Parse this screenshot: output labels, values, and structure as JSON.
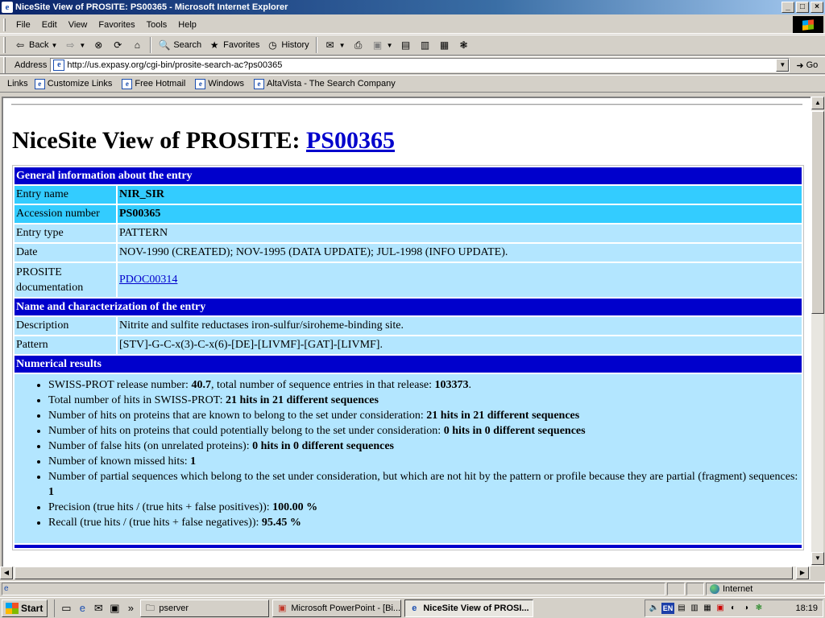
{
  "window": {
    "title": "NiceSite View of PROSITE: PS00365 - Microsoft Internet Explorer",
    "controls": [
      "_",
      "□",
      "×"
    ]
  },
  "menu": [
    "File",
    "Edit",
    "View",
    "Favorites",
    "Tools",
    "Help"
  ],
  "toolbar": {
    "back": "Back",
    "search": "Search",
    "favorites": "Favorites",
    "history": "History"
  },
  "address": {
    "label": "Address",
    "url": "http://us.expasy.org/cgi-bin/prosite-search-ac?ps00365",
    "go": "Go"
  },
  "links": {
    "label": "Links",
    "items": [
      "Customize Links",
      "Free Hotmail",
      "Windows",
      "AltaVista - The Search Company"
    ]
  },
  "page": {
    "title_prefix": "NiceSite View of PROSITE: ",
    "title_link": "PS00365",
    "sections": {
      "general": "General information about the entry",
      "name": "Name and characterization of the entry",
      "numerical": "Numerical results"
    },
    "general": {
      "entry_name_label": "Entry name",
      "entry_name": "NIR_SIR",
      "accession_label": "Accession number",
      "accession": "PS00365",
      "type_label": "Entry type",
      "type": "PATTERN",
      "date_label": "Date",
      "date": "NOV-1990 (CREATED); NOV-1995 (DATA UPDATE); JUL-1998 (INFO UPDATE).",
      "doc_label": "PROSITE documentation",
      "doc": "PDOC00314"
    },
    "characterization": {
      "description_label": "Description",
      "description": "Nitrite and sulfite reductases iron-sulfur/siroheme-binding site.",
      "pattern_label": "Pattern",
      "pattern": "[STV]-G-C-x(3)-C-x(6)-[DE]-[LIVMF]-[GAT]-[LIVMF]."
    },
    "results": [
      {
        "text": "SWISS-PROT release number: ",
        "b1": "40.7",
        "mid": ", total number of sequence entries in that release: ",
        "b2": "103373",
        "end": "."
      },
      {
        "text": "Total number of hits in SWISS-PROT: ",
        "b1": "21 hits in 21 different sequences"
      },
      {
        "text": "Number of hits on proteins that are known to belong to the set under consideration: ",
        "b1": "21 hits in 21 different sequences"
      },
      {
        "text": "Number of hits on proteins that could potentially belong to the set under consideration: ",
        "b1": "0 hits in 0 different sequences"
      },
      {
        "text": "Number of false hits (on unrelated proteins): ",
        "b1": "0 hits in 0 different sequences"
      },
      {
        "text": "Number of known missed hits: ",
        "b1": "1"
      },
      {
        "text": "Number of partial sequences which belong to the set under consideration, but which are not hit by the pattern or profile because they are partial (fragment) sequences: ",
        "b1": "1"
      },
      {
        "text": "Precision (true hits / (true hits + false positives)): ",
        "b1": "100.00 %"
      },
      {
        "text": "Recall (true hits / (true hits + false negatives)): ",
        "b1": "95.45 %"
      }
    ]
  },
  "status": {
    "zone": "Internet"
  },
  "taskbar": {
    "start": "Start",
    "tasks": [
      "pserver",
      "Microsoft PowerPoint - [Bi...",
      "NiceSite View of PROSI..."
    ],
    "lang": "EN",
    "clock": "18:19"
  }
}
